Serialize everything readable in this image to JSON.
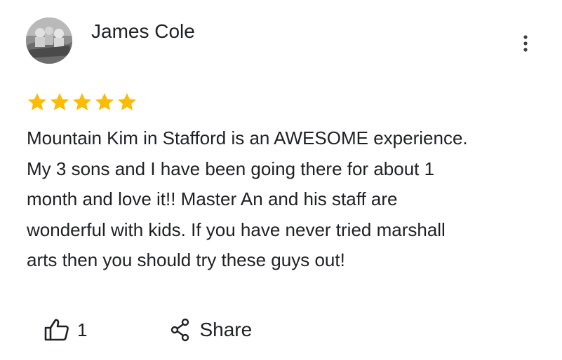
{
  "review": {
    "reviewer_name": "James Cole",
    "rating": 5,
    "rating_max": 5,
    "star_color": "#fbbc04",
    "text": "Mountain Kim in Stafford is an AWESOME experience.\nMy 3 sons and I have been going there for about 1\nmonth and love it!!  Master An and his staff are\nwonderful with kids.  If you have never tried marshall\narts then you should try these guys out!"
  },
  "actions": {
    "like_count": "1",
    "share_label": "Share"
  },
  "icons": {
    "more": "more-vert-icon",
    "like": "thumb-up-icon",
    "share": "share-icon",
    "star": "star-icon"
  }
}
